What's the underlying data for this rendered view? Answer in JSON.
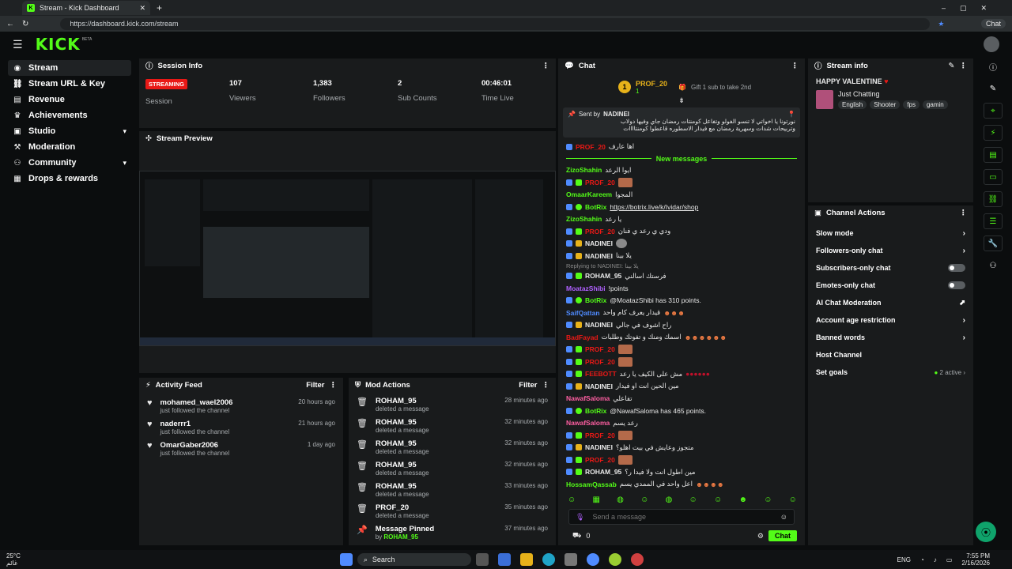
{
  "browser": {
    "tab_title": "Stream - Kick Dashboard",
    "url": "https://dashboard.kick.com/stream",
    "chat_button": "Chat"
  },
  "brand": {
    "logo": "KICK",
    "beta": "BETA",
    "accent": "#53fc18"
  },
  "sidebar": {
    "items": [
      {
        "label": "Stream",
        "icon": "broadcast-icon"
      },
      {
        "label": "Stream URL & Key",
        "icon": "link-icon"
      },
      {
        "label": "Revenue",
        "icon": "revenue-icon"
      },
      {
        "label": "Achievements",
        "icon": "trophy-icon"
      },
      {
        "label": "Studio",
        "icon": "studio-icon"
      },
      {
        "label": "Moderation",
        "icon": "hammer-icon"
      },
      {
        "label": "Community",
        "icon": "community-icon"
      },
      {
        "label": "Drops & rewards",
        "icon": "gift-icon"
      }
    ]
  },
  "session": {
    "title": "Session Info",
    "status": "STREAMING",
    "status_label": "Session",
    "viewers": "107",
    "viewers_label": "Viewers",
    "followers": "1,383",
    "followers_label": "Followers",
    "subs": "2",
    "subs_label": "Sub Counts",
    "time": "00:46:01",
    "time_label": "Time Live"
  },
  "preview": {
    "title": "Stream Preview"
  },
  "activity": {
    "title": "Activity Feed",
    "filter": "Filter",
    "items": [
      {
        "name": "mohamed_wael2006",
        "action": "just followed the channel",
        "time": "20 hours ago"
      },
      {
        "name": "naderrr1",
        "action": "just followed the channel",
        "time": "21 hours ago"
      },
      {
        "name": "OmarGaber2006",
        "action": "just followed the channel",
        "time": "1 day ago"
      }
    ]
  },
  "mod": {
    "title": "Mod Actions",
    "filter": "Filter",
    "items": [
      {
        "name": "ROHAM_95",
        "action": "deleted a message",
        "time": "28 minutes ago"
      },
      {
        "name": "ROHAM_95",
        "action": "deleted a message",
        "time": "32 minutes ago"
      },
      {
        "name": "ROHAM_95",
        "action": "deleted a message",
        "time": "32 minutes ago"
      },
      {
        "name": "ROHAM_95",
        "action": "deleted a message",
        "time": "32 minutes ago"
      },
      {
        "name": "ROHAM_95",
        "action": "deleted a message",
        "time": "33 minutes ago"
      },
      {
        "name": "PROF_20",
        "action": "deleted a message",
        "time": "35 minutes ago"
      }
    ],
    "pinned": {
      "name": "Message Pinned",
      "by": "by",
      "user": "ROHAM_95",
      "time": "37 minutes ago"
    }
  },
  "chat": {
    "title": "Chat",
    "gifter": "PROF_20",
    "gifter_rank": "1",
    "gifter_count": "1",
    "gift_text": "Gift 1 sub to take 2nd",
    "pinned_sent_by": "Sent by",
    "pinned_user": "NADINEI",
    "pinned_text1": "نورتونا يا اخواتي لا تنسو الفولو وتفاعل كومنتات رمضان جاي وفيها دولاب",
    "pinned_text2": "وتربيحات شدات وسهرية رمضان مع فيدار الاسطوره قاعطوا كومنتاااات",
    "new_messages": "New messages",
    "lines": [
      {
        "user": "PROF_20",
        "color": "#e91916",
        "text": "اها عارف"
      },
      {
        "user": "ZizoShahin",
        "color": "#53fc18",
        "text": "ايوا الرعد"
      },
      {
        "user": "PROF_20",
        "color": "#e91916",
        "text": ""
      },
      {
        "user": "OmaarKareem",
        "color": "#53fc18",
        "text": "المجوا"
      },
      {
        "user": "BotRix",
        "color": "#53fc18",
        "text": "https://botrix.live/k/Ividar/shop"
      },
      {
        "user": "ZizoShahin",
        "color": "#53fc18",
        "text": "يا رعد"
      },
      {
        "user": "PROF_20",
        "color": "#e91916",
        "text": "ودي ي رعد ي فنان"
      },
      {
        "user": "NADINEI",
        "color": "#ffffff",
        "text": ""
      },
      {
        "user": "NADINEI",
        "color": "#ffffff",
        "text": "يلا بينا"
      },
      {
        "user": "ROHAM_95",
        "color": "#ffffff",
        "text": "فرستك اسالني"
      },
      {
        "user": "MoatazShibi",
        "color": "#b060ff",
        "text": "!points"
      },
      {
        "user": "BotRix",
        "color": "#53fc18",
        "text": "@MoatazShibi has 310 points."
      },
      {
        "user": "SaifQattan",
        "color": "#4f8bff",
        "text": "قيدار يعرف كام واحد"
      },
      {
        "user": "NADINEI",
        "color": "#ffffff",
        "text": "راح اشوف في جالي"
      },
      {
        "user": "BadFayad",
        "color": "#e91916",
        "text": "اسمك ومنك و تفوتك وطلبات"
      },
      {
        "user": "PROF_20",
        "color": "#e91916",
        "text": ""
      },
      {
        "user": "PROF_20",
        "color": "#e91916",
        "text": ""
      },
      {
        "user": "FEEBOTT",
        "color": "#e91916",
        "text": "مش على الكيف يا رعد"
      },
      {
        "user": "NADINEI",
        "color": "#ffffff",
        "text": "مين الحين انت او فيدار"
      },
      {
        "user": "NawafSaloma",
        "color": "#ff5fa2",
        "text": "تفاعلي"
      },
      {
        "user": "BotRix",
        "color": "#53fc18",
        "text": "@NawafSaloma has 465 points."
      },
      {
        "user": "NawafSaloma",
        "color": "#ff5fa2",
        "text": "رعد يسم"
      },
      {
        "user": "PROF_20",
        "color": "#e91916",
        "text": ""
      },
      {
        "user": "NADINEI",
        "color": "#ffffff",
        "text": "متجوز وعايش في بيت اهلو؟"
      },
      {
        "user": "PROF_20",
        "color": "#e91916",
        "text": ""
      },
      {
        "user": "ROHAM_95",
        "color": "#ffffff",
        "text": "مين اطول انت ولا فيدا ر؟"
      },
      {
        "user": "HossamQassab",
        "color": "#53fc18",
        "text": "اعل واحد في الممدي يسم"
      }
    ],
    "reply_note": "Replying to NADINEI: يلا بينا",
    "placeholder": "Send a message",
    "count": "0",
    "send": "Chat"
  },
  "stream_info": {
    "title": "Stream info",
    "stream_title": "HAPPY VALENTINE",
    "category": "Just Chatting",
    "tags": [
      "English",
      "Shooter",
      "fps",
      "gamin"
    ]
  },
  "channel_actions": {
    "title": "Channel Actions",
    "items": [
      {
        "label": "Slow mode",
        "ctrl": "arrow"
      },
      {
        "label": "Followers-only chat",
        "ctrl": "arrow"
      },
      {
        "label": "Subscribers-only chat",
        "ctrl": "toggle"
      },
      {
        "label": "Emotes-only chat",
        "ctrl": "toggle"
      },
      {
        "label": "AI Chat Moderation",
        "ctrl": "chart"
      },
      {
        "label": "Account age restriction",
        "ctrl": "arrow"
      },
      {
        "label": "Banned words",
        "ctrl": "arrow"
      },
      {
        "label": "Host Channel",
        "ctrl": "none"
      },
      {
        "label": "Set goals",
        "ctrl": "arrow",
        "extra": "2 active"
      }
    ]
  },
  "taskbar": {
    "temp": "25°C",
    "weather_sub": "غائم",
    "search": "Search",
    "lang": "ENG",
    "time": "7:55 PM",
    "date": "2/16/2026"
  }
}
